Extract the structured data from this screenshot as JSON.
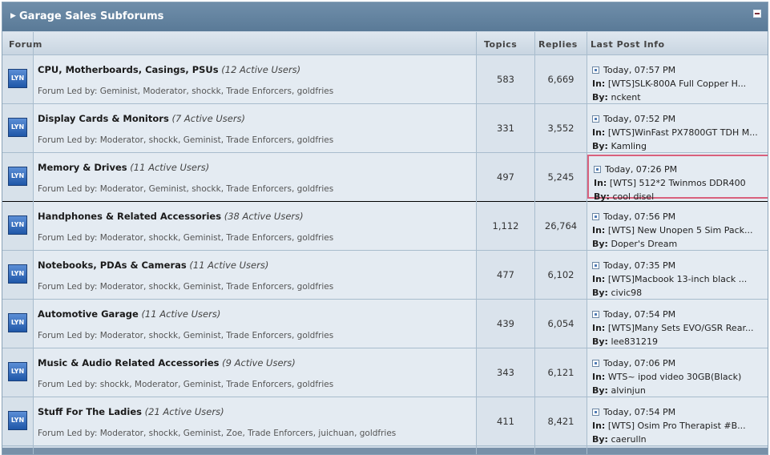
{
  "panel": {
    "title": "Garage Sales Subforums"
  },
  "columns": {
    "forum": "Forum",
    "topics": "Topics",
    "replies": "Replies",
    "last_post": "Last Post Info"
  },
  "labels": {
    "in": "In:",
    "by": "By:",
    "icon_text": "LYN"
  },
  "forums": [
    {
      "name": "CPU, Motherboards, Casings, PSUs",
      "active": "(12 Active Users)",
      "led": "Forum Led by: Geminist, Moderator, shockk, Trade Enforcers, goldfries",
      "topics": "583",
      "replies": "6,669",
      "time": "Today, 07:57 PM",
      "thread": "[WTS]SLK-800A Full Copper H...",
      "author": "nckent"
    },
    {
      "name": "Display Cards & Monitors",
      "active": "(7 Active Users)",
      "led": "Forum Led by: Moderator, shockk, Geminist, Trade Enforcers, goldfries",
      "topics": "331",
      "replies": "3,552",
      "time": "Today, 07:52 PM",
      "thread": "[WTS]WinFast PX7800GT TDH M...",
      "author": "Kamling"
    },
    {
      "name": "Memory & Drives",
      "active": "(11 Active Users)",
      "led": "Forum Led by: Moderator, Geminist, shockk, Trade Enforcers, goldfries",
      "topics": "497",
      "replies": "5,245",
      "time": "Today, 07:26 PM",
      "thread": "[WTS] 512*2 Twinmos DDR400",
      "author": "cool disel"
    },
    {
      "name": "Handphones & Related Accessories",
      "active": "(38 Active Users)",
      "led": "Forum Led by: Moderator, shockk, Geminist, Trade Enforcers, goldfries",
      "topics": "1,112",
      "replies": "26,764",
      "time": "Today, 07:56 PM",
      "thread": "[WTS] New Unopen 5 Sim Pack...",
      "author": "Doper's Dream"
    },
    {
      "name": "Notebooks, PDAs & Cameras",
      "active": "(11 Active Users)",
      "led": "Forum Led by: Moderator, shockk, Geminist, Trade Enforcers, goldfries",
      "topics": "477",
      "replies": "6,102",
      "time": "Today, 07:35 PM",
      "thread": "[WTS]Macbook 13-inch black ...",
      "author": "civic98"
    },
    {
      "name": "Automotive Garage",
      "active": "(11 Active Users)",
      "led": "Forum Led by: Moderator, shockk, Geminist, Trade Enforcers, goldfries",
      "topics": "439",
      "replies": "6,054",
      "time": "Today, 07:54 PM",
      "thread": "[WTS]Many Sets EVO/GSR Rear...",
      "author": "lee831219"
    },
    {
      "name": "Music & Audio Related Accessories",
      "active": "(9 Active Users)",
      "led": "Forum Led by: shockk, Moderator, Geminist, Trade Enforcers, goldfries",
      "topics": "343",
      "replies": "6,121",
      "time": "Today, 07:06 PM",
      "thread": "WTS~ ipod video 30GB(Black)",
      "author": "alvinjun"
    },
    {
      "name": "Stuff For The Ladies",
      "active": "(21 Active Users)",
      "led": "Forum Led by: Moderator, shockk, Geminist, Zoe, Trade Enforcers, juichuan, goldfries",
      "topics": "411",
      "replies": "8,421",
      "time": "Today, 07:54 PM",
      "thread": "[WTS] Osim Pro Therapist #B...",
      "author": "caerulln"
    }
  ]
}
